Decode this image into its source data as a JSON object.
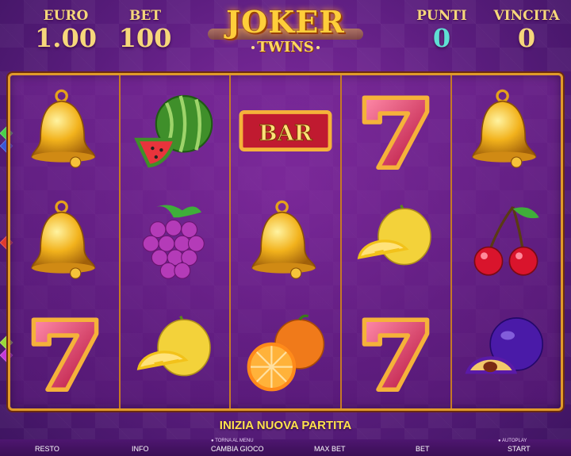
{
  "stats": {
    "euro": {
      "label": "EURO",
      "value": "1.00"
    },
    "bet": {
      "label": "BET",
      "value": "100"
    },
    "punti": {
      "label": "PUNTI",
      "value": "0"
    },
    "vincita": {
      "label": "VINCITA",
      "value": "0"
    }
  },
  "logo": {
    "title": "JOKER",
    "subtitle": "TWINS"
  },
  "reels": [
    [
      "bell",
      "bell",
      "seven"
    ],
    [
      "watermelon",
      "grapes",
      "lemon"
    ],
    [
      "bar",
      "bell",
      "orange"
    ],
    [
      "seven",
      "lemon",
      "seven"
    ],
    [
      "bell",
      "cherries",
      "plum"
    ]
  ],
  "bar_label": "BAR",
  "banner": "INIZIA NUOVA PARTITA",
  "bottom_buttons": {
    "resto": "RESTO",
    "info": "INFO",
    "torna_al_menu": "TORNA AL MENU",
    "cambia_gioco": "CAMBIA GIOCO",
    "max_bet": "MAX BET",
    "bet": "BET",
    "autoplay": "AUTOPLAY",
    "start": "START"
  },
  "colors": {
    "gold": "#f6d77b",
    "cyan": "#5fe0d4",
    "frame": "#e09a2a",
    "banner": "#ffe24d"
  }
}
